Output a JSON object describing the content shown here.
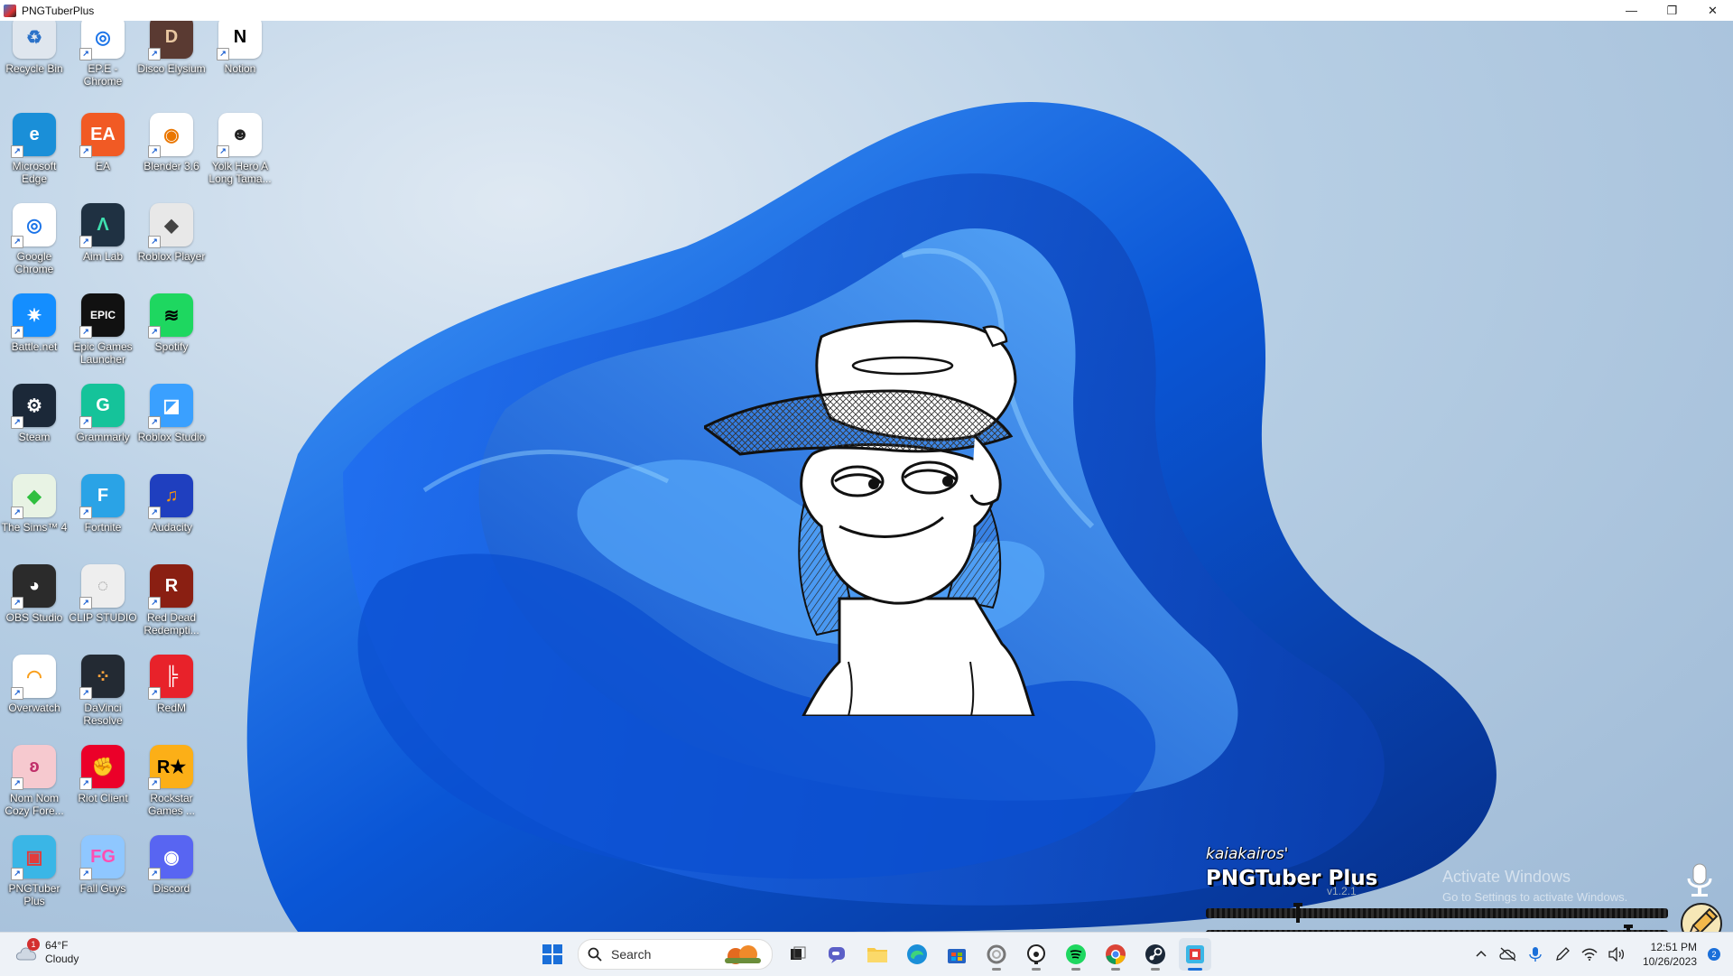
{
  "window": {
    "title": "PNGTuberPlus",
    "controls": {
      "minimize": "—",
      "restore": "❐",
      "close": "✕"
    }
  },
  "desktop_icons": [
    {
      "label": "Recycle Bin",
      "icon": "recycle-bin-icon",
      "color": "#dfe6ee",
      "glyph": "♻",
      "fg": "#2b72c9",
      "shortcut": false
    },
    {
      "label": "EP.E - Chrome",
      "icon": "chrome-icon",
      "color": "#ffffff",
      "glyph": "◎",
      "fg": "#1a73e8",
      "shortcut": true
    },
    {
      "label": "Disco Elysium",
      "icon": "disco-elysium-icon",
      "color": "#5a3a32",
      "glyph": "D",
      "fg": "#e9c7a1",
      "shortcut": true
    },
    {
      "label": "Notion",
      "icon": "notion-icon",
      "color": "#ffffff",
      "glyph": "N",
      "fg": "#000000",
      "shortcut": true
    },
    {
      "label": "Microsoft Edge",
      "icon": "edge-icon",
      "color": "#1a8fd8",
      "glyph": "e",
      "fg": "#ffffff",
      "shortcut": true
    },
    {
      "label": "EA",
      "icon": "ea-icon",
      "color": "#f15a24",
      "glyph": "EA",
      "fg": "#ffffff",
      "shortcut": true
    },
    {
      "label": "Blender 3.6",
      "icon": "blender-icon",
      "color": "#ffffff",
      "glyph": "◉",
      "fg": "#ea7600",
      "shortcut": true
    },
    {
      "label": "Yolk Hero A Long Tama...",
      "icon": "yolk-hero-icon",
      "color": "#ffffff",
      "glyph": "☻",
      "fg": "#222222",
      "shortcut": true
    },
    {
      "label": "Google Chrome",
      "icon": "chrome-icon",
      "color": "#ffffff",
      "glyph": "◎",
      "fg": "#1a73e8",
      "shortcut": true
    },
    {
      "label": "Aim Lab",
      "icon": "aim-lab-icon",
      "color": "#1f3142",
      "glyph": "Λ",
      "fg": "#3fe0b0",
      "shortcut": true
    },
    {
      "label": "Roblox Player",
      "icon": "roblox-icon",
      "color": "#e8e8e8",
      "glyph": "◆",
      "fg": "#444444",
      "shortcut": true
    },
    {
      "label": "",
      "icon": "",
      "color": "",
      "glyph": "",
      "fg": "",
      "shortcut": false
    },
    {
      "label": "Battle.net",
      "icon": "battlenet-icon",
      "color": "#148eff",
      "glyph": "✷",
      "fg": "#ffffff",
      "shortcut": true
    },
    {
      "label": "Epic Games Launcher",
      "icon": "epic-games-icon",
      "color": "#111111",
      "glyph": "EPIC",
      "fg": "#ffffff",
      "shortcut": true
    },
    {
      "label": "Spotify",
      "icon": "spotify-icon",
      "color": "#1ed760",
      "glyph": "≋",
      "fg": "#000000",
      "shortcut": true
    },
    {
      "label": "",
      "icon": "",
      "color": "",
      "glyph": "",
      "fg": "",
      "shortcut": false
    },
    {
      "label": "Steam",
      "icon": "steam-icon",
      "color": "#1b2838",
      "glyph": "⚙",
      "fg": "#ffffff",
      "shortcut": true
    },
    {
      "label": "Grammarly",
      "icon": "grammarly-icon",
      "color": "#15c39a",
      "glyph": "G",
      "fg": "#ffffff",
      "shortcut": true
    },
    {
      "label": "Roblox Studio",
      "icon": "roblox-studio-icon",
      "color": "#3aa0ff",
      "glyph": "◪",
      "fg": "#ffffff",
      "shortcut": true
    },
    {
      "label": "",
      "icon": "",
      "color": "",
      "glyph": "",
      "fg": "",
      "shortcut": false
    },
    {
      "label": "The Sims™ 4",
      "icon": "sims-icon",
      "color": "#e8f3e4",
      "glyph": "◆",
      "fg": "#2fbf3f",
      "shortcut": true
    },
    {
      "label": "Fortnite",
      "icon": "fortnite-icon",
      "color": "#2aa3e6",
      "glyph": "F",
      "fg": "#ffffff",
      "shortcut": true
    },
    {
      "label": "Audacity",
      "icon": "audacity-icon",
      "color": "#1f3fbf",
      "glyph": "♫",
      "fg": "#ff9800",
      "shortcut": true
    },
    {
      "label": "",
      "icon": "",
      "color": "",
      "glyph": "",
      "fg": "",
      "shortcut": false
    },
    {
      "label": "OBS Studio",
      "icon": "obs-icon",
      "color": "#2b2b2b",
      "glyph": "◕",
      "fg": "#ffffff",
      "shortcut": true
    },
    {
      "label": "CLIP STUDIO",
      "icon": "clip-studio-icon",
      "color": "#eeeeee",
      "glyph": "◌",
      "fg": "#888888",
      "shortcut": true
    },
    {
      "label": "Red Dead Redempti...",
      "icon": "red-dead-icon",
      "color": "#8a1f12",
      "glyph": "R",
      "fg": "#ffffff",
      "shortcut": true
    },
    {
      "label": "",
      "icon": "",
      "color": "",
      "glyph": "",
      "fg": "",
      "shortcut": false
    },
    {
      "label": "Overwatch",
      "icon": "overwatch-icon",
      "color": "#ffffff",
      "glyph": "◠",
      "fg": "#f99e1a",
      "shortcut": true
    },
    {
      "label": "DaVinci Resolve",
      "icon": "davinci-resolve-icon",
      "color": "#232a33",
      "glyph": "⁘",
      "fg": "#ffa43d",
      "shortcut": true
    },
    {
      "label": "RedM",
      "icon": "redm-icon",
      "color": "#e8222a",
      "glyph": "╠",
      "fg": "#ffffff",
      "shortcut": true
    },
    {
      "label": "",
      "icon": "",
      "color": "",
      "glyph": "",
      "fg": "",
      "shortcut": false
    },
    {
      "label": "Nom Nom Cozy Fore...",
      "icon": "nom-nom-icon",
      "color": "#f6c9cf",
      "glyph": "ʚ",
      "fg": "#c0306a",
      "shortcut": true
    },
    {
      "label": "Riot Client",
      "icon": "riot-client-icon",
      "color": "#eb0029",
      "glyph": "✊",
      "fg": "#ffffff",
      "shortcut": true
    },
    {
      "label": "Rockstar Games ...",
      "icon": "rockstar-icon",
      "color": "#fcaf17",
      "glyph": "R★",
      "fg": "#000000",
      "shortcut": true
    },
    {
      "label": "",
      "icon": "",
      "color": "",
      "glyph": "",
      "fg": "",
      "shortcut": false
    },
    {
      "label": "PNGTuber Plus",
      "icon": "pngtuber-plus-icon",
      "color": "#3ab6e6",
      "glyph": "▣",
      "fg": "#e23b3b",
      "shortcut": true
    },
    {
      "label": "Fall Guys",
      "icon": "fall-guys-icon",
      "color": "#8fc7ff",
      "glyph": "FG",
      "fg": "#ff4fb3",
      "shortcut": true
    },
    {
      "label": "Discord",
      "icon": "discord-icon",
      "color": "#5865f2",
      "glyph": "◉",
      "fg": "#ffffff",
      "shortcut": true
    },
    {
      "label": "",
      "icon": "",
      "color": "",
      "glyph": "",
      "fg": "",
      "shortcut": false
    }
  ],
  "pngtuber": {
    "brand_small": "kaiakairos'",
    "brand_large": "PNGTuber Plus",
    "version": "v1.2.1",
    "volume_level": 0.2,
    "threshold_level": 0.915
  },
  "watermark": {
    "title": "Activate Windows",
    "subtitle": "Go to Settings to activate Windows."
  },
  "taskbar": {
    "weather": {
      "temp": "64°F",
      "condition": "Cloudy",
      "badge": "1"
    },
    "search_placeholder": "Search",
    "apps": [
      "start-icon",
      "search-icon",
      "task-view-icon",
      "chat-icon",
      "file-explorer-icon",
      "edge-icon",
      "store-icon",
      "clip-studio-icon",
      "yolk-hero-icon",
      "spotify-icon",
      "chrome-icon",
      "steam-icon",
      "pngtuber-plus-icon"
    ],
    "clock": {
      "time": "12:51 PM",
      "date": "10/26/2023"
    },
    "notifications": "2"
  },
  "colors": {
    "accent": "#1a6fd9",
    "taskbar_bg": "#eef2f7"
  }
}
